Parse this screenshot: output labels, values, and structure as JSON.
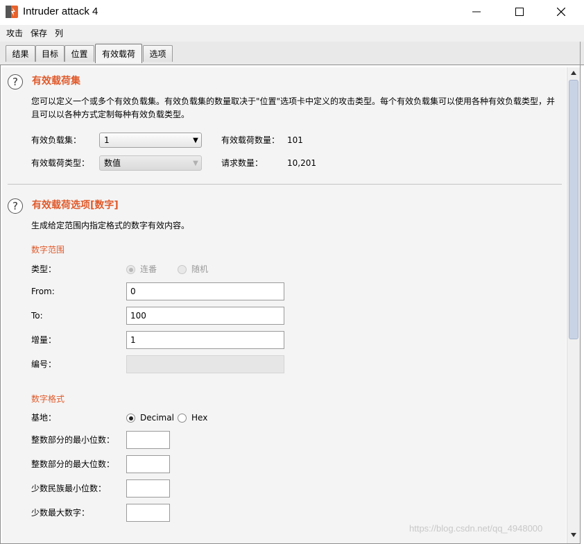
{
  "window": {
    "title": "Intruder attack 4",
    "controls": [
      "minimize-icon",
      "maximize-icon",
      "close-icon"
    ]
  },
  "menu": {
    "items": [
      "攻击",
      "保存",
      "列"
    ]
  },
  "tabs": [
    {
      "label": "结果",
      "active": false
    },
    {
      "label": "目标",
      "active": false
    },
    {
      "label": "位置",
      "active": false
    },
    {
      "label": "有效载荷",
      "active": true
    },
    {
      "label": "选项",
      "active": false
    }
  ],
  "payload_sets": {
    "title": "有效载荷集",
    "description": "您可以定义一个或多个有效负载集。有效负载集的数量取决于\"位置\"选项卡中定义的攻击类型。每个有效负载集可以使用各种有效负载类型，并且可以以各种方式定制每种有效负载类型。",
    "set_label": "有效负载集：",
    "set_value": "1",
    "type_label": "有效载荷类型：",
    "type_value": "数值",
    "count_label": "有效载荷数量：",
    "count_value": "101",
    "requests_label": "请求数量：",
    "requests_value": "10,201"
  },
  "payload_options": {
    "title": "有效载荷选项[数字]",
    "description": "生成给定范围内指定格式的数字有效内容。",
    "range": {
      "title": "数字范围",
      "type_label": "类型：",
      "type_sequential": "连番",
      "type_random": "随机",
      "from_label": "From:",
      "from_value": "0",
      "to_label": "To:",
      "to_value": "100",
      "step_label": "增量：",
      "step_value": "1",
      "how_many_label": "编号：",
      "how_many_value": ""
    },
    "format": {
      "title": "数字格式",
      "base_label": "基地：",
      "base_decimal": "Decimal",
      "base_hex": "Hex",
      "min_int_label": "整数部分的最小位数：",
      "min_int_value": "",
      "max_int_label": "整数部分的最大位数：",
      "max_int_value": "",
      "min_frac_label": "少数民族最小位数：",
      "min_frac_value": "",
      "max_frac_label": "少数最大数字：",
      "max_frac_value": ""
    }
  },
  "watermark": "https://blog.csdn.net/qq_4948000",
  "colors": {
    "accent": "#e05a2b",
    "panel_bg": "#f4f4f4",
    "scroll_thumb": "#c8d4e6"
  }
}
